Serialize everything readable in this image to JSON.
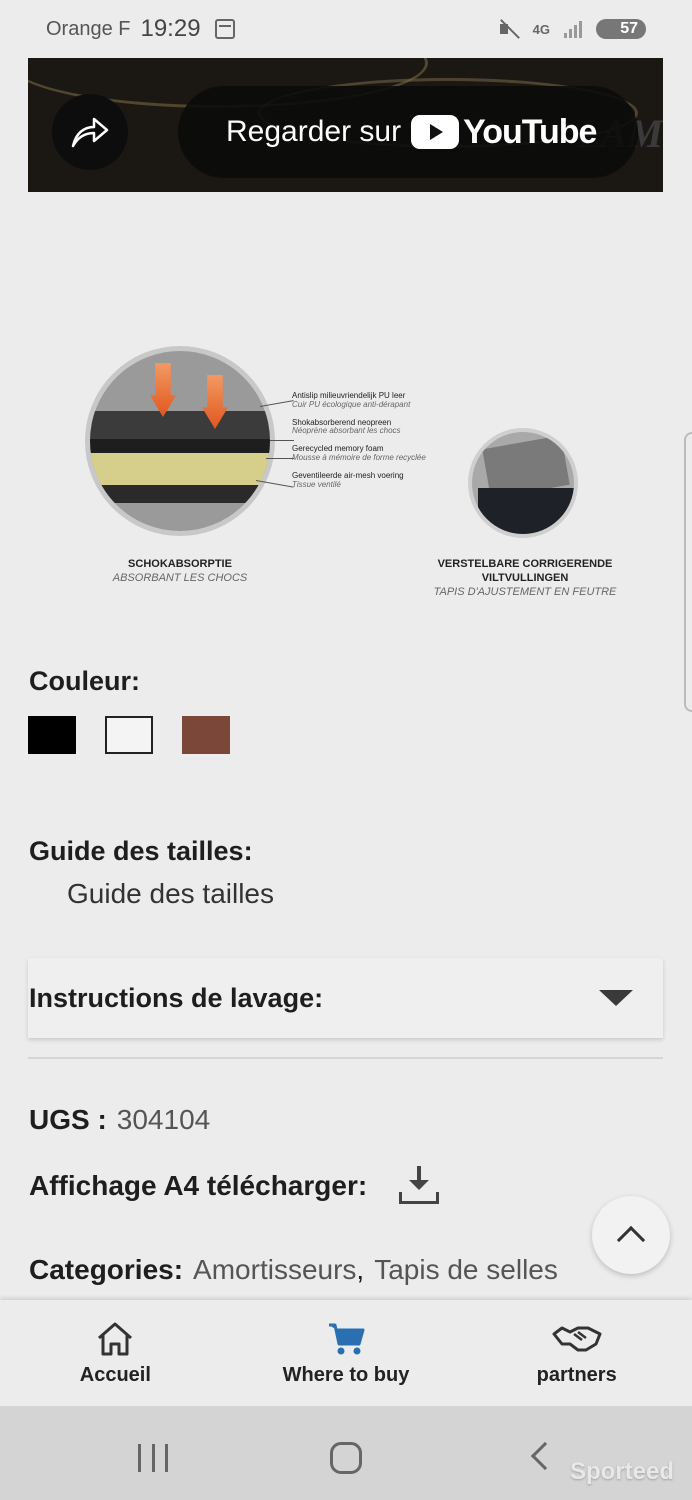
{
  "status_bar": {
    "carrier": "Orange F",
    "time": "19:29",
    "network": "4G",
    "battery": "57",
    "icons": [
      "calendar-icon",
      "mute-icon",
      "network-icon",
      "signal-icon",
      "battery-icon"
    ]
  },
  "video": {
    "watch_on_label": "Regarder sur",
    "youtube_wordmark": "YouTube",
    "watermark_text": "LAM",
    "icons": [
      "share-icon",
      "youtube-logo-icon"
    ]
  },
  "illustration": {
    "callouts": [
      {
        "nl": "Antislip milieuvriendelijk PU leer",
        "fr": "Cuir PU écologique anti-dérapant"
      },
      {
        "nl": "Shokabsorberend neopreen",
        "fr": "Néoprène absorbant les chocs"
      },
      {
        "nl": "Gerecycled memory foam",
        "fr": "Mousse à mémoire de forme recyclée"
      },
      {
        "nl": "Geventileerde air-mesh voering",
        "fr": "Tissue ventilé"
      }
    ],
    "caption_left": {
      "main": "SCHOKABSORPTIE",
      "sub": "ABSORBANT LES CHOCS"
    },
    "caption_right": {
      "main_line1": "VERSTELBARE CORRIGERENDE",
      "main_line2": "VILTVULLINGEN",
      "sub": "TAPIS D'AJUSTEMENT EN FEUTRE"
    }
  },
  "color_section": {
    "label": "Couleur",
    "label_suffix": ":",
    "swatches": [
      {
        "name": "black",
        "color": "#000000"
      },
      {
        "name": "white",
        "color": "#f4f4f4"
      },
      {
        "name": "brown",
        "color": "#7a4738"
      }
    ]
  },
  "size_guide": {
    "label": "Guide des tailles",
    "label_suffix": ":",
    "link_text": "Guide des tailles"
  },
  "washing": {
    "label": "Instructions de lavage",
    "label_suffix": ":"
  },
  "meta": {
    "sku_label": "UGS :",
    "sku_value": "304104",
    "a4_label": "Affichage A4 télécharger:",
    "categories_label": "Categories:",
    "categories": [
      "Amortisseurs",
      "Tapis de selles"
    ],
    "category_separator": ","
  },
  "bottom_nav": {
    "items": [
      {
        "label": "Accueil",
        "icon": "home-icon"
      },
      {
        "label": "Where to buy",
        "icon": "cart-icon",
        "color": "#2b6fb3"
      },
      {
        "label": "partners",
        "icon": "handshake-icon"
      }
    ]
  },
  "watermark": {
    "text": "Sporteed"
  }
}
